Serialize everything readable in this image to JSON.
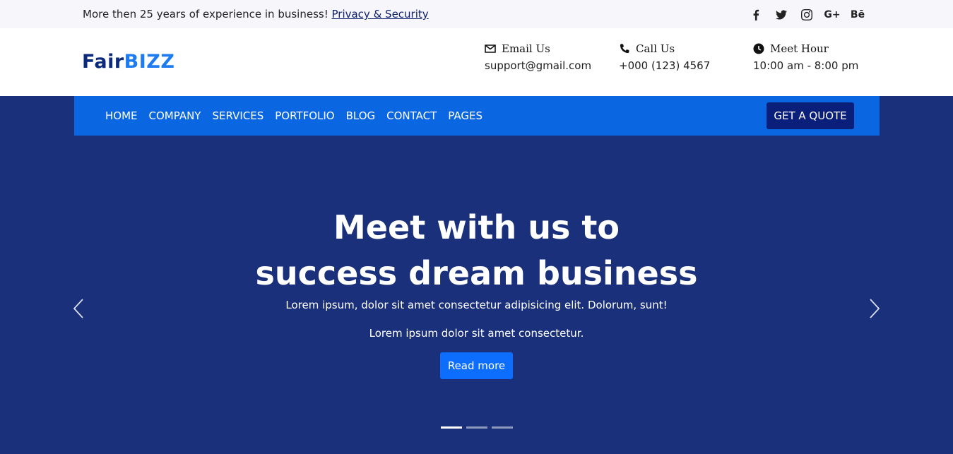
{
  "topbar": {
    "message": "More then 25 years of experience in business!",
    "link_text": "Privacy & Security",
    "socials": [
      {
        "icon": "facebook-icon",
        "glyph": "f"
      },
      {
        "icon": "twitter-icon",
        "glyph": ""
      },
      {
        "icon": "instagram-icon",
        "glyph": ""
      },
      {
        "icon": "google-plus-icon",
        "glyph": "G+"
      },
      {
        "icon": "behance-icon",
        "glyph": "Bē"
      }
    ]
  },
  "brand": {
    "part1": "Fair",
    "part2": "BIZZ",
    "color_dark": "#0b2a7a",
    "color_accent": "#1f7bf0"
  },
  "contact": {
    "email": {
      "title": "Email Us",
      "value": "support@gmail.com",
      "icon": "envelope-icon"
    },
    "call": {
      "title": "Call Us",
      "value": "+000 (123) 4567",
      "icon": "phone-icon"
    },
    "hours": {
      "title": "Meet Hour",
      "value": "10:00 am - 8:00 pm",
      "icon": "clock-icon"
    }
  },
  "nav": {
    "items": [
      "HOME",
      "COMPANY",
      "SERVICES",
      "PORTFOLIO",
      "BLOG",
      "CONTACT",
      "PAGES"
    ],
    "cta": "GET A QUOTE",
    "bg_color": "#0a67e1"
  },
  "hero": {
    "title_line1": "Meet with us to",
    "title_line2": "success dream business",
    "subtitle1": "Lorem ipsum, dolor sit amet consectetur adipisicing elit. Dolorum, sunt!",
    "subtitle2": "Lorem ipsum dolor sit amet consectetur.",
    "button": "Read more",
    "bg_color": "#1a307b",
    "slides_total": 3,
    "active_slide": 1
  }
}
